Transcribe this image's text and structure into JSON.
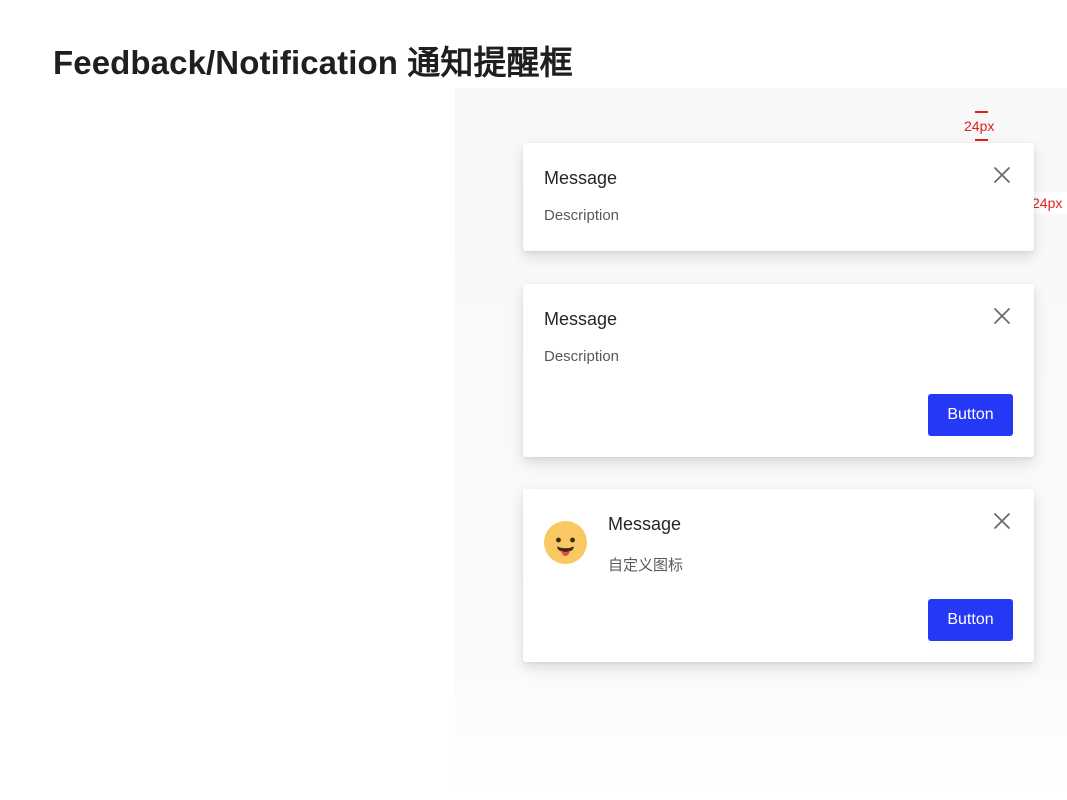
{
  "page": {
    "title": "Feedback/Notification 通知提醒框"
  },
  "annotations": {
    "top_spacing": "24px",
    "right_spacing": "24px"
  },
  "notifications": [
    {
      "title": "Message",
      "description": "Description",
      "close_icon": "close-icon"
    },
    {
      "title": "Message",
      "description": "Description",
      "button_label": "Button",
      "close_icon": "close-icon"
    },
    {
      "title": "Message",
      "description": "自定义图标",
      "button_label": "Button",
      "close_icon": "close-icon",
      "custom_icon": "smiley-face-icon"
    }
  ],
  "colors": {
    "primary": "#2438f5",
    "annotation": "#e0201b",
    "title_text": "#262626",
    "description_text": "#595959",
    "icon_face": "#fac862"
  }
}
